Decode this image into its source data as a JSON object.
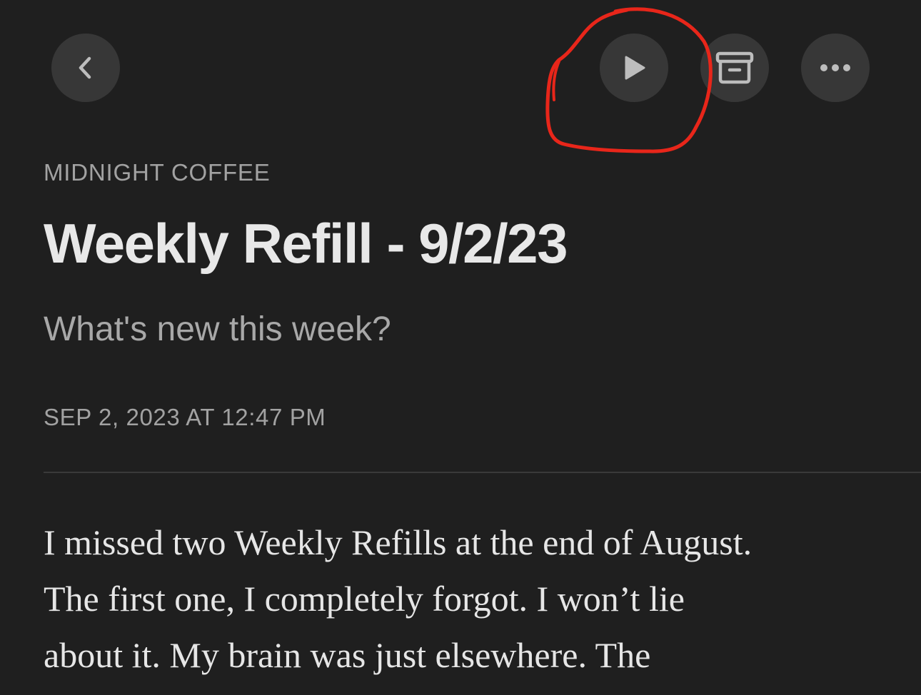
{
  "toolbar": {
    "back_icon": "chevron-left-icon",
    "play_icon": "play-icon",
    "archive_icon": "archive-box-icon",
    "more_icon": "ellipsis-icon"
  },
  "article": {
    "publication": "MIDNIGHT COFFEE",
    "title": "Weekly Refill - 9/2/23",
    "subtitle": "What's new this week?",
    "date": "SEP 2, 2023 AT 12:47 PM",
    "body_lines": [
      "I missed two Weekly Refills at the end of August.",
      "The first one, I completely forgot. I won’t lie",
      "about it. My brain was just elsewhere. The"
    ]
  },
  "colors": {
    "background": "#1f1f1f",
    "button_bg": "#373737",
    "icon": "#bdbdbd",
    "annotation": "#e8261a"
  }
}
